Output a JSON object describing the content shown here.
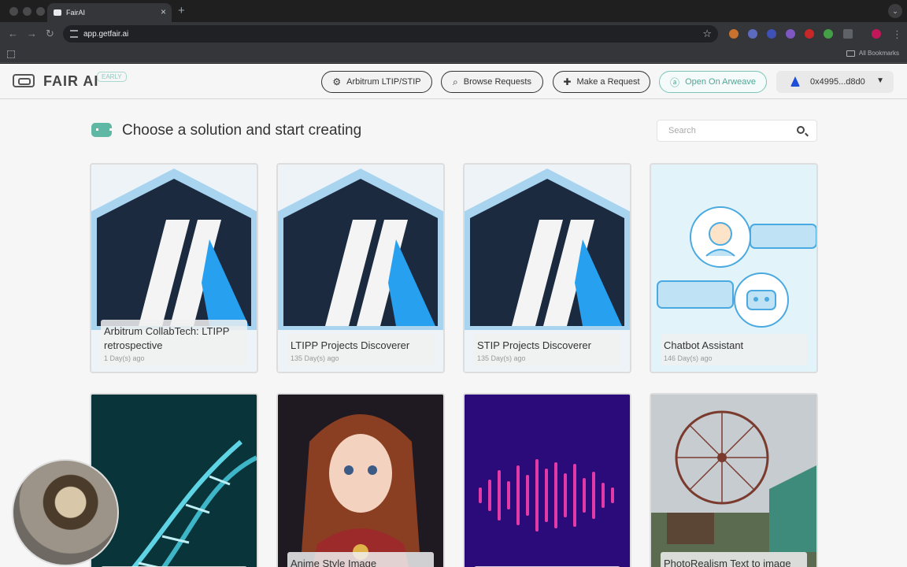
{
  "browser": {
    "tab_title": "FairAI",
    "tab_close": "×",
    "new_tab": "+",
    "url": "app.getfair.ai",
    "all_bookmarks": "All Bookmarks"
  },
  "header": {
    "logo": "FAIR AI",
    "badge": "EARLY",
    "buttons": [
      {
        "label": "Arbitrum LTIP/STIP",
        "icon": "gear-icon"
      },
      {
        "label": "Browse Requests",
        "icon": "search-icon"
      },
      {
        "label": "Make a Request",
        "icon": "message-plus-icon"
      },
      {
        "label": "Open On Arweave",
        "icon": "arweave-icon"
      }
    ],
    "wallet": "0x4995...d8d0"
  },
  "main": {
    "title": "Choose a solution and start creating",
    "search_placeholder": "Search"
  },
  "cards": [
    {
      "title": "Arbitrum CollabTech: LTIPP retrospective",
      "date": "1 Day(s) ago",
      "image": "arbitrum-logo"
    },
    {
      "title": "LTIPP Projects Discoverer",
      "date": "135 Day(s) ago",
      "image": "arbitrum-logo"
    },
    {
      "title": "STIP Projects Discoverer",
      "date": "135 Day(s) ago",
      "image": "arbitrum-logo"
    },
    {
      "title": "Chatbot Assistant",
      "date": "146 Day(s) ago",
      "image": "chatbot-illustration"
    },
    {
      "title": "",
      "date": "",
      "image": "dna-helix"
    },
    {
      "title": "Anime Style Image",
      "date": "",
      "image": "anime-portrait"
    },
    {
      "title": "",
      "date": "",
      "image": "sound-wave"
    },
    {
      "title": "PhotoRealism Text to image",
      "date": "",
      "image": "ferris-wheel-photo"
    }
  ],
  "colors": {
    "accent_teal": "#5fb8a4",
    "arbitrum_navy": "#1b2a3f",
    "arbitrum_blue": "#28a0f0",
    "sound_bg": "#2b0a7a",
    "sound_wave": "#e23aa6"
  }
}
